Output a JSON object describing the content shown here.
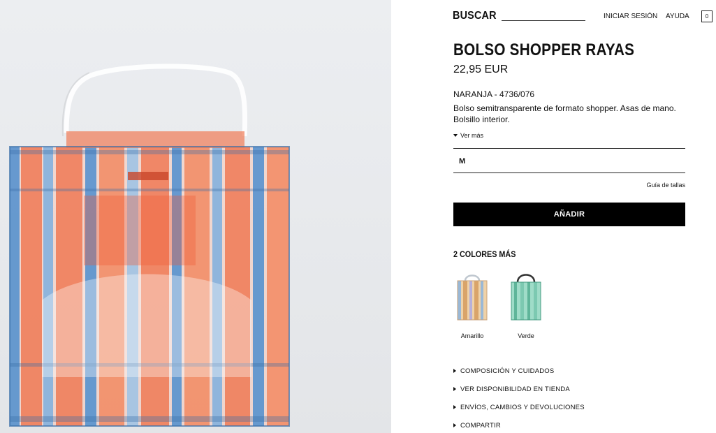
{
  "header": {
    "search_label": "BUSCAR",
    "login_label": "INICIAR SESIÓN",
    "help_label": "AYUDA",
    "cart_count": "0"
  },
  "product": {
    "name": "BOLSO SHOPPER RAYAS",
    "price": "22,95 EUR",
    "color_ref": "NARANJA - 4736/076",
    "description": "Bolso semitransparente de formato shopper. Asas de mano. Bolsillo interior.",
    "see_more": "Ver más",
    "selected_size": "M",
    "size_guide": "Guía de tallas",
    "add_button": "AÑADIR"
  },
  "colors": {
    "heading": "2 COLORES MÁS",
    "options": [
      {
        "label": "Amarillo",
        "accent": "#d9a46a"
      },
      {
        "label": "Verde",
        "accent": "#5fb59a"
      }
    ]
  },
  "accordion": [
    "COMPOSICIÓN Y CUIDADOS",
    "VER DISPONIBILIDAD EN TIENDA",
    "ENVÍOS, CAMBIOS Y DEVOLUCIONES",
    "COMPARTIR"
  ],
  "theme": {
    "stripe_orange": "#f07a55",
    "stripe_blue": "#4f8fcf",
    "background": "#e9ebee"
  }
}
